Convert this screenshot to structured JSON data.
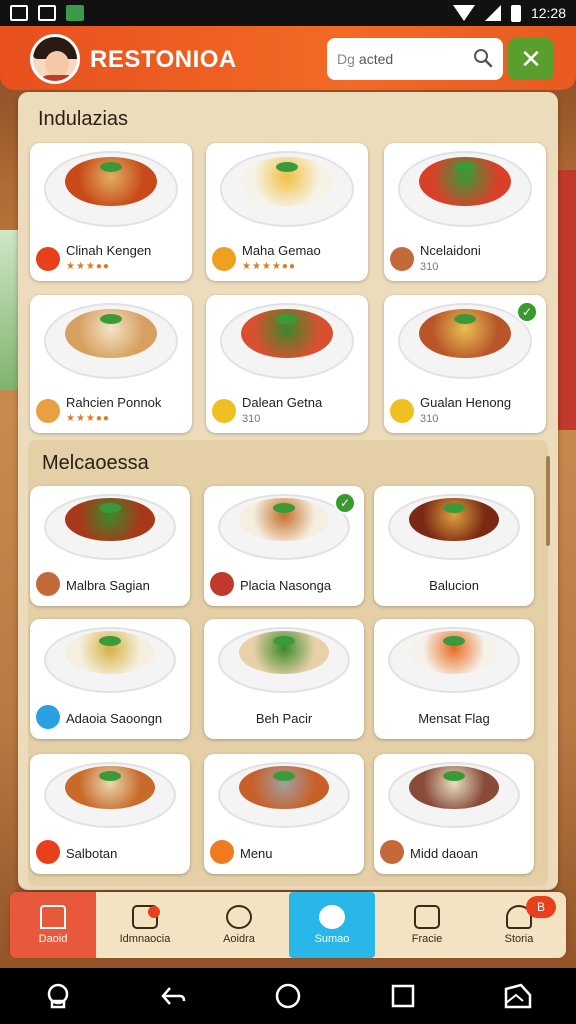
{
  "status_bar": {
    "time": "12:28"
  },
  "header": {
    "app_title": "RESTONIOA",
    "search_prefix": "Dg",
    "search_value": "acted",
    "close_label": "✕",
    "accent_color": "#f26a24",
    "close_color": "#5a9e2e"
  },
  "section1": {
    "title": "Indulazias",
    "cards": [
      {
        "name": "Clinah Kengen",
        "rating": "★★★●●",
        "icon": "cart-icon",
        "icon_color": "#e8401a"
      },
      {
        "name": "Maha Gemao",
        "rating": "★★★★●●",
        "icon": "star-icon",
        "icon_color": "#f0a020"
      },
      {
        "name": "Ncelaidoni",
        "sub": "310",
        "icon": "avatar-icon",
        "icon_color": "#c46a3a"
      },
      {
        "name": "Rahcien Ponnok",
        "rating": "★★★●●",
        "icon": "food-icon",
        "icon_color": "#e8a040"
      },
      {
        "name": "Dalean Getna",
        "sub": "310",
        "icon": "coin-icon",
        "icon_color": "#f0c020"
      },
      {
        "name": "Gualan Henong",
        "sub": "310",
        "icon": "coin-icon",
        "icon_color": "#f0c020",
        "checked": true
      }
    ]
  },
  "section2": {
    "title": "Melcaoessa",
    "cards": [
      {
        "name": "Malbra Sagian",
        "icon": "avatar-icon",
        "icon_color": "#c46a3a"
      },
      {
        "name": "Placia Nasonga",
        "icon": "avatar-icon",
        "icon_color": "#c0392b",
        "checked": true
      },
      {
        "name": "Balucion"
      },
      {
        "name": "Adaoia Saoongn",
        "icon": "chef-icon",
        "icon_color": "#29a0e0"
      },
      {
        "name": "Beh Pacir"
      },
      {
        "name": "Mensat Flag"
      },
      {
        "name": "Salbotan",
        "icon": "cart-icon",
        "icon_color": "#e8401a"
      },
      {
        "name": "Menu",
        "icon": "utensils-icon",
        "icon_color": "#f07a20"
      },
      {
        "name": "Midd daoan",
        "icon": "avatar-icon",
        "icon_color": "#c46a3a"
      }
    ]
  },
  "bottom_nav": {
    "items": [
      {
        "label": "Daoid",
        "icon": "home-icon"
      },
      {
        "label": "Idmnaocia",
        "icon": "edit-icon"
      },
      {
        "label": "Aoidra",
        "icon": "leaf-icon"
      },
      {
        "label": "Sumao",
        "icon": "chef-icon"
      },
      {
        "label": "Fracie",
        "icon": "list-icon"
      },
      {
        "label": "Storia",
        "icon": "store-icon",
        "badge": "B"
      }
    ]
  }
}
